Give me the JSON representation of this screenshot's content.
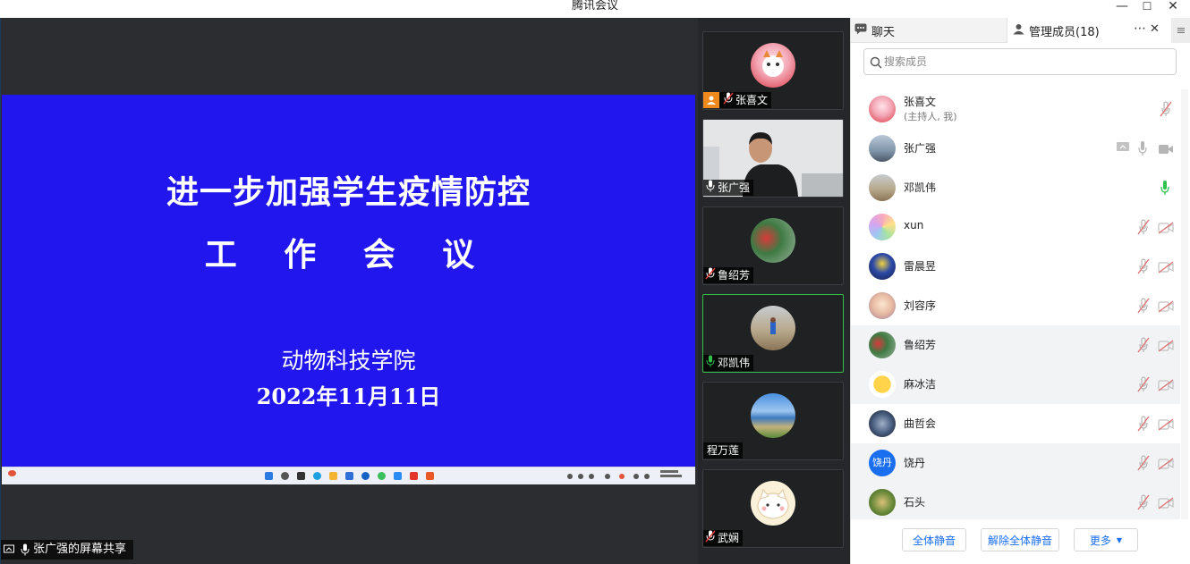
{
  "window": {
    "title": "腾讯会议",
    "minimize": "—",
    "maximize": "☐",
    "close": "✕"
  },
  "slide": {
    "title_line1": "进一步加强学生疫情防控",
    "title_line2": "工 作 会 议",
    "org": "动物科技学院",
    "date": "2022年11月11日",
    "bg_color": "#2116ee"
  },
  "screen_share": {
    "label": "张广强的屏幕共享"
  },
  "tiles": [
    {
      "name": "张喜文",
      "host": true,
      "muted": true,
      "active": false,
      "kind": "avatar"
    },
    {
      "name": "张广强",
      "host": false,
      "muted": false,
      "active": false,
      "kind": "video"
    },
    {
      "name": "鲁绍芳",
      "host": false,
      "muted": true,
      "active": false,
      "kind": "avatar"
    },
    {
      "name": "邓凯伟",
      "host": false,
      "muted": false,
      "active": true,
      "kind": "avatar"
    },
    {
      "name": "程万莲",
      "host": false,
      "muted": null,
      "active": false,
      "kind": "avatar"
    },
    {
      "name": "武娴",
      "host": false,
      "muted": true,
      "active": false,
      "kind": "avatar"
    }
  ],
  "panel": {
    "tab_chat": "聊天",
    "tab_members": "管理成员(18)",
    "search_placeholder": "搜索成员",
    "members": [
      {
        "name": "张喜文",
        "sub": "(主持人, 我)",
        "mic": "muted",
        "video": "none",
        "share": false
      },
      {
        "name": "张广强",
        "sub": "",
        "mic": "on-gray",
        "video": "on",
        "share": true
      },
      {
        "name": "邓凯伟",
        "sub": "",
        "mic": "speaking",
        "video": "none",
        "share": false
      },
      {
        "name": "xun",
        "sub": "",
        "mic": "muted",
        "video": "off",
        "share": false
      },
      {
        "name": "雷晨昱",
        "sub": "",
        "mic": "muted",
        "video": "off",
        "share": false
      },
      {
        "name": "刘容序",
        "sub": "",
        "mic": "muted",
        "video": "off",
        "share": false
      },
      {
        "name": "鲁绍芳",
        "sub": "",
        "mic": "muted",
        "video": "off",
        "share": false
      },
      {
        "name": "麻冰洁",
        "sub": "",
        "mic": "muted",
        "video": "off",
        "share": false
      },
      {
        "name": "曲哲会",
        "sub": "",
        "mic": "muted",
        "video": "off",
        "share": false
      },
      {
        "name": "饶丹",
        "sub": "",
        "mic": "muted",
        "video": "off",
        "share": false,
        "avatar_text": "饶丹"
      },
      {
        "name": "石头",
        "sub": "",
        "mic": "muted",
        "video": "off",
        "share": false
      }
    ],
    "footer": {
      "mute_all": "全体静音",
      "unmute_all": "解除全体静音",
      "more": "更多"
    }
  },
  "colors": {
    "accent": "#1a6ef0",
    "speaking": "#2fbf4a",
    "host_badge": "#f08a1c"
  }
}
